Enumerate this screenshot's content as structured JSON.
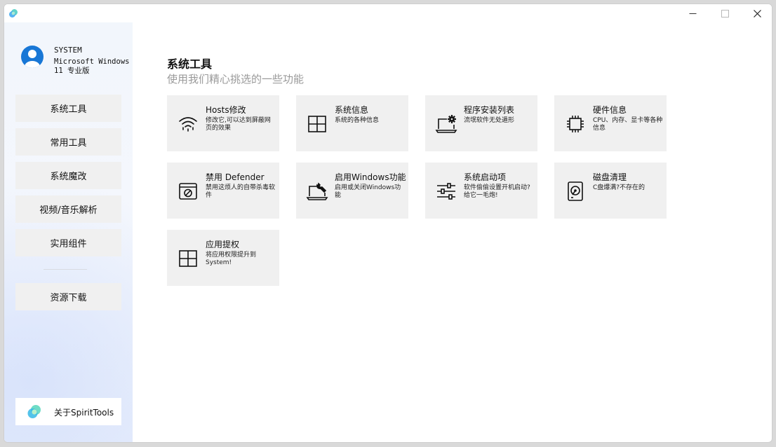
{
  "user": {
    "name": "SYSTEM",
    "os": "Microsoft Windows 11 专业版"
  },
  "nav": [
    {
      "label": "系统工具"
    },
    {
      "label": "常用工具"
    },
    {
      "label": "系统魔改"
    },
    {
      "label": "视频/音乐解析"
    },
    {
      "label": "实用组件"
    },
    {
      "label": "资源下载"
    }
  ],
  "about": {
    "label": "关于SpiritTools"
  },
  "main": {
    "title": "系统工具",
    "subtitle": "使用我们精心挑选的一些功能"
  },
  "cards": [
    {
      "title": "Hosts修改",
      "desc": "修改它,可以达到屏蔽网页的效果",
      "icon": "wifi-signal-icon"
    },
    {
      "title": "系统信息",
      "desc": "系统的各种信息",
      "icon": "windows-logo-icon"
    },
    {
      "title": "程序安装列表",
      "desc": "流氓软件无处遁形",
      "icon": "laptop-gear-icon"
    },
    {
      "title": "硬件信息",
      "desc": "CPU、内存、显卡等各种信息",
      "icon": "chip-icon"
    },
    {
      "title": "禁用 Defender",
      "desc": "禁用这烦人的自带杀毒软件",
      "icon": "window-block-icon"
    },
    {
      "title": "启用Windows功能",
      "desc": "启用或关闭Windows功能",
      "icon": "laptop-wrench-icon"
    },
    {
      "title": "系统启动项",
      "desc": "软件偷偷设置开机启动?给它一毛炮!",
      "icon": "sliders-icon"
    },
    {
      "title": "磁盘清理",
      "desc": "C盘爆满?不存在的",
      "icon": "disk-icon"
    },
    {
      "title": "应用提权",
      "desc": "将应用权限提升到System!",
      "icon": "windows-logo-icon"
    }
  ]
}
